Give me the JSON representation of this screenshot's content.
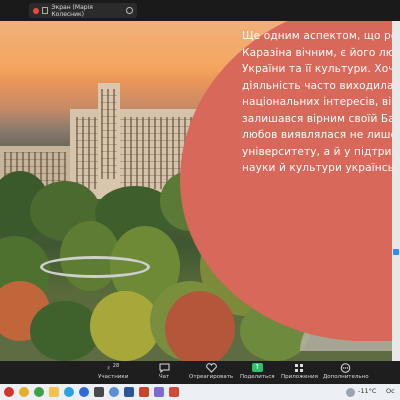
{
  "share_label": "Экран (Марія Колесник)",
  "slide": {
    "lines": [
      "Ще одним аспектом, що робит",
      "Каразіна вічним, є його любов",
      "України та її культури. Хоча йо",
      "діяльність часто виходила за м",
      "національних інтересів, він зав",
      "залишався вірним своїй Батькі",
      "любов виявлялася не лише у с",
      "університету, а й у підтримці р",
      "науки й культури українського"
    ]
  },
  "toolbar": {
    "participants_label": "Участники",
    "participants_count": "28",
    "chat_label": "Чат",
    "react_label": "Отреагировать",
    "share_label": "Поделиться",
    "apps_label": "Приложения",
    "more_label": "Дополнительно"
  },
  "taskbar": {
    "temperature": "-11°C",
    "truncated_text": "Ос"
  },
  "colors": {
    "blob": "#d7685a",
    "share_green": "#2cc36b",
    "toolbar_bg": "#1e1e1e"
  }
}
